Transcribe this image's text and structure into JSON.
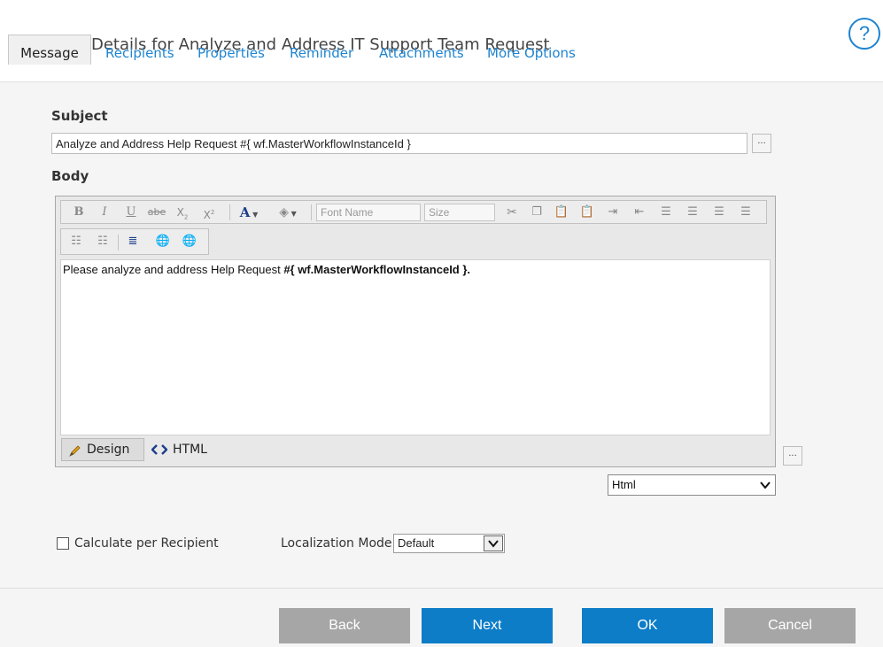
{
  "header": {
    "title": "Details for Analyze and Address IT Support Team Request",
    "help_label": "?"
  },
  "tabs": [
    {
      "label": "Message",
      "active": true
    },
    {
      "label": "Recipients"
    },
    {
      "label": "Properties"
    },
    {
      "label": "Reminder"
    },
    {
      "label": "Attachments"
    },
    {
      "label": "More Options"
    }
  ],
  "subject": {
    "label": "Subject",
    "value": "Analyze and Address Help Request #{ wf.MasterWorkflowInstanceId }",
    "more_label": "..."
  },
  "body": {
    "label": "Body",
    "toolbar": {
      "font_name_placeholder": "Font Name",
      "size_placeholder": "Size"
    },
    "content_prefix": "Please analyze and address Help Request ",
    "content_bold": "#{ wf.MasterWorkflowInstanceId }.",
    "mode_design": "Design",
    "mode_html": "HTML",
    "more_label": "..."
  },
  "format": {
    "selected": "Html"
  },
  "options": {
    "calculate_label": "Calculate per Recipient",
    "localization_label": "Localization Mode",
    "localization_value": "Default"
  },
  "footer": {
    "back": "Back",
    "next": "Next",
    "ok": "OK",
    "cancel": "Cancel"
  },
  "colors": {
    "link": "#1e84d0",
    "primary_button": "#0d7dc8",
    "secondary_button": "#a6a6a6"
  }
}
